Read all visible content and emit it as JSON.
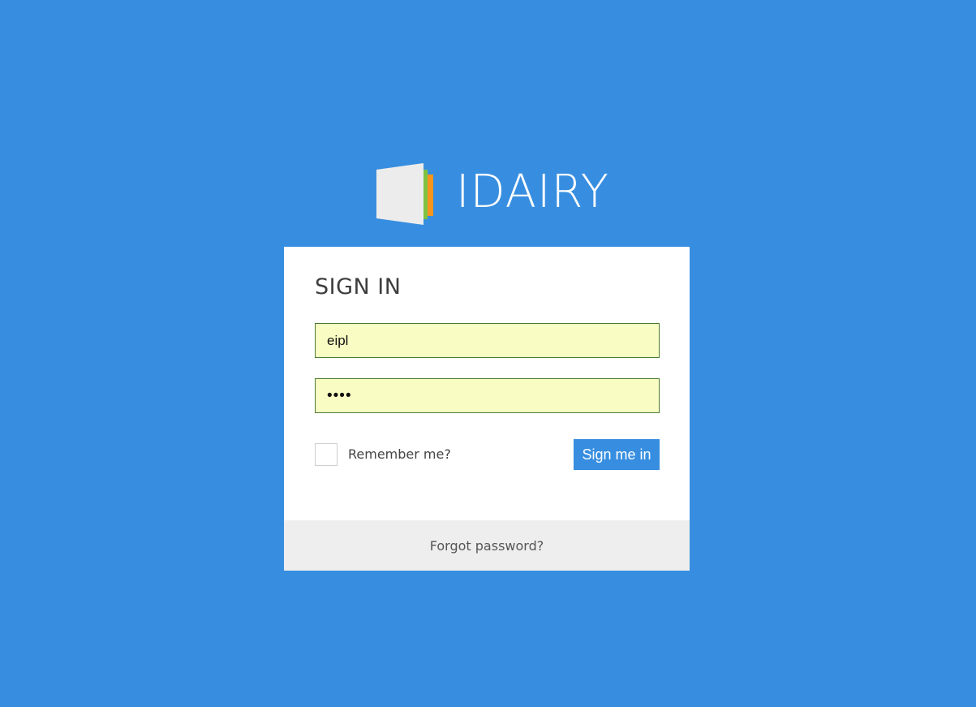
{
  "brand": {
    "name": "IDAIRY",
    "logo_icon": "book-pages-icon",
    "logo_colors": [
      "#ececec",
      "#7cc242",
      "#f7941d"
    ]
  },
  "login": {
    "title": "SIGN IN",
    "username": {
      "value": "eipl",
      "background": "#fafdc3"
    },
    "password": {
      "value": "••••"
    },
    "remember": {
      "label": "Remember me?",
      "checked": false
    },
    "submit_label": "Sign me in",
    "forgot_label": "Forgot password?"
  },
  "colors": {
    "background": "#378ee0",
    "card": "#ffffff",
    "footer": "#eeeeee",
    "button": "#378ee0"
  }
}
